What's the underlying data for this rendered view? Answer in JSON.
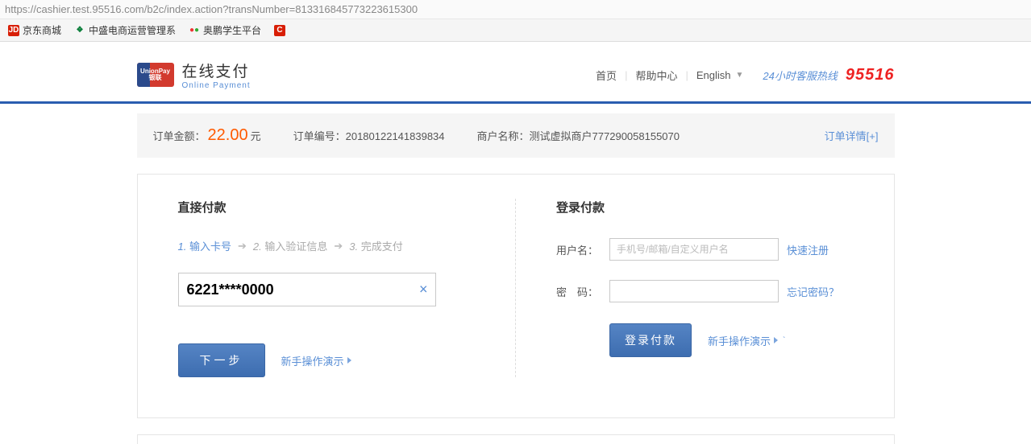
{
  "browser": {
    "url": "https://cashier.test.95516.com/b2c/index.action?transNumber=813316845773223615300",
    "bookmarks": [
      {
        "label": "京东商城"
      },
      {
        "label": "中盛电商运营管理系"
      },
      {
        "label": "奥鹏学生平台"
      }
    ]
  },
  "header": {
    "brand_cn": "在线支付",
    "brand_en": "Online Payment",
    "badge_top": "UnionPay",
    "badge_bottom": "银联",
    "links": {
      "home": "首页",
      "help": "帮助中心",
      "lang": "English"
    },
    "hotline_label": "24小时客服热线",
    "hotline_number": "95516"
  },
  "order": {
    "amount_label": "订单金额：",
    "amount": "22.00",
    "unit": "元",
    "orderno_label": "订单编号：",
    "orderno": "20180122141839834",
    "merchant_label": "商户名称：",
    "merchant": "测试虚拟商户777290058155070",
    "detail": "订单详情[+]"
  },
  "direct": {
    "title": "直接付款",
    "step1_num": "1.",
    "step1": "输入卡号",
    "step2_num": "2.",
    "step2": "输入验证信息",
    "step3_num": "3.",
    "step3": "完成支付",
    "card_value": "6221****0000",
    "next": "下一步",
    "demo": "新手操作演示"
  },
  "login": {
    "title": "登录付款",
    "user_label": "用户名：",
    "user_placeholder": "手机号/邮箱/自定义用户名",
    "register": "快速注册",
    "pwd_label": "密　码：",
    "forgot": "忘记密码？",
    "submit": "登录付款",
    "demo": "新手操作演示"
  }
}
